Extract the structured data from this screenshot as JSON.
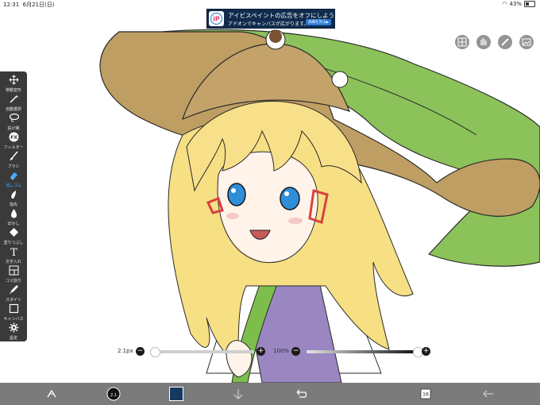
{
  "status": {
    "time": "12:31",
    "date": "6月21日(日)",
    "battery": "43%",
    "battery_level": 0.43
  },
  "ad": {
    "title": "アイビスペイントの広告をオフにしよう!",
    "subtitle": "アドオンでキャンバスが広がります。",
    "button": "詳細を見る▶",
    "logo_text": "iP"
  },
  "toolbar": {
    "items": [
      {
        "label": "移動変形",
        "icon": "move-icon"
      },
      {
        "label": "自動選択",
        "icon": "magic-wand-icon"
      },
      {
        "label": "投げ縄",
        "icon": "lasso-icon"
      },
      {
        "label": "フィルター",
        "icon": "fx-icon",
        "glyph": "FX"
      },
      {
        "label": "ブラシ",
        "icon": "brush-icon"
      },
      {
        "label": "消しゴム",
        "icon": "eraser-icon"
      },
      {
        "label": "指先",
        "icon": "finger-icon"
      },
      {
        "label": "ぼかし",
        "icon": "blur-icon"
      },
      {
        "label": "塗りつぶし",
        "icon": "fill-icon"
      },
      {
        "label": "文字入れ",
        "icon": "text-icon",
        "glyph": "T"
      },
      {
        "label": "コマ割り",
        "icon": "frame-divider-icon"
      },
      {
        "label": "スポイト",
        "icon": "eyedropper-icon"
      },
      {
        "label": "キャンバス",
        "icon": "canvas-icon"
      },
      {
        "label": "設定",
        "icon": "settings-icon"
      }
    ],
    "active": "消しゴム"
  },
  "brush_size": {
    "label": "2.1px",
    "minus": "−",
    "plus": "+",
    "value": 0.03
  },
  "opacity": {
    "label": "100%",
    "minus": "−",
    "plus": "+",
    "value": 1.0
  },
  "bottom": {
    "layer_count": "16",
    "color": "#163a5e",
    "brush_preview": "2.1"
  },
  "colors": {
    "toolbar_bg": "#3a3a3a",
    "accent": "#4aa8ff",
    "bottom_bar": "#7b7b7b"
  }
}
